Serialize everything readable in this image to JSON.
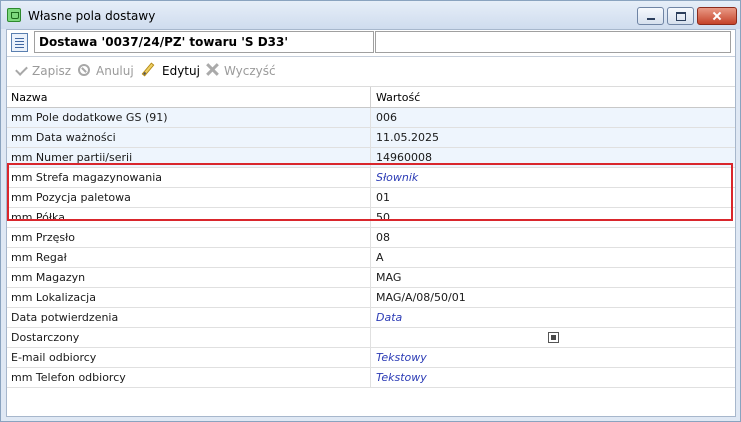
{
  "window": {
    "title": "Własne pola dostawy"
  },
  "header": {
    "headline": "Dostawa '0037/24/PZ' towaru 'S D33'"
  },
  "toolbar": {
    "save_label": "Zapisz",
    "cancel_label": "Anuluj",
    "edit_label": "Edytuj",
    "clear_label": "Wyczyść"
  },
  "grid": {
    "columns": {
      "name": "Nazwa",
      "value": "Wartość"
    },
    "rows": [
      {
        "name": "mm Pole dodatkowe GS (91)",
        "value": "006"
      },
      {
        "name": "mm Data ważności",
        "value": "11.05.2025"
      },
      {
        "name": "mm Numer partii/serii",
        "value": "14960008"
      },
      {
        "name": "mm Strefa magazynowania",
        "value": "Słownik"
      },
      {
        "name": "mm Pozycja paletowa",
        "value": "01"
      },
      {
        "name": "mm Półka",
        "value": "50"
      },
      {
        "name": "mm Przęsło",
        "value": "08"
      },
      {
        "name": "mm Regał",
        "value": "A"
      },
      {
        "name": "mm Magazyn",
        "value": "MAG"
      },
      {
        "name": "mm Lokalizacja",
        "value": "MAG/A/08/50/01"
      },
      {
        "name": "Data potwierdzenia",
        "value": "Data"
      },
      {
        "name": "Dostarczony",
        "value": ""
      },
      {
        "name": "E-mail odbiorcy",
        "value": "Tekstowy"
      },
      {
        "name": "mm Telefon odbiorcy",
        "value": "Tekstowy"
      }
    ]
  },
  "colors": {
    "highlight_border": "#d9262c",
    "type_hint_text": "#2b3bb5"
  },
  "icons": [
    "app-icon",
    "document-icon",
    "check-icon",
    "cancel-icon",
    "pencil-icon",
    "clear-x-icon"
  ]
}
